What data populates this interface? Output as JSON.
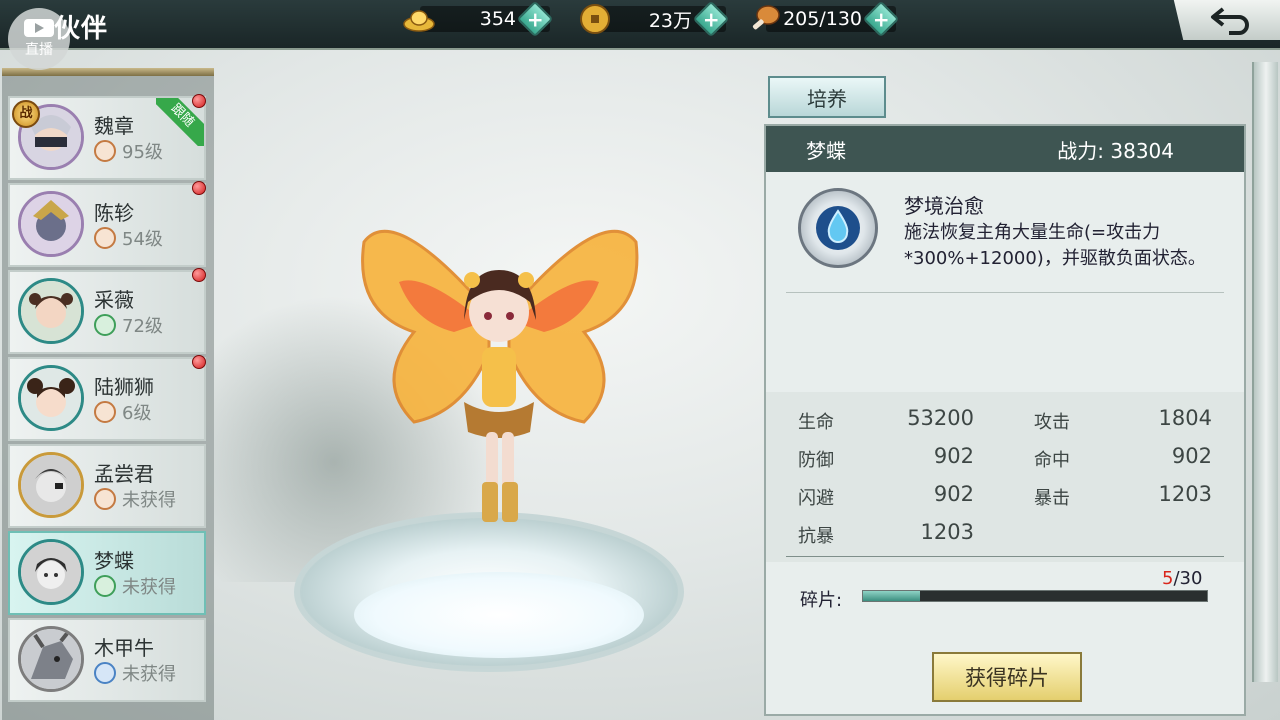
{
  "header": {
    "title": "伙伴",
    "live_label": "直播",
    "resources": [
      {
        "name": "gold-ingot",
        "value": "354"
      },
      {
        "name": "copper-coin",
        "value": "23万"
      },
      {
        "name": "stamina",
        "value": "205/130"
      }
    ],
    "plus_symbol": "+"
  },
  "partners": [
    {
      "name": "魏章",
      "level": "95级",
      "badge": "跟随",
      "combat_badge": "战",
      "class": "orange",
      "selected": false
    },
    {
      "name": "陈轸",
      "level": "54级",
      "class": "orange",
      "selected": false
    },
    {
      "name": "采薇",
      "level": "72级",
      "class": "green",
      "selected": false
    },
    {
      "name": "陆狮狮",
      "level": "6级",
      "class": "orange",
      "selected": false
    },
    {
      "name": "孟尝君",
      "level": "未获得",
      "class": "orange",
      "selected": false
    },
    {
      "name": "梦蝶",
      "level": "未获得",
      "class": "green",
      "selected": true
    },
    {
      "name": "木甲牛",
      "level": "未获得",
      "class": "blue",
      "selected": false
    }
  ],
  "panel": {
    "tab_label": "培养",
    "partner_name": "梦蝶",
    "power_label": "战力:",
    "power_value": "38304",
    "skill": {
      "title": "梦境治愈",
      "description": "施法恢复主角大量生命(=攻击力*300%+12000)，并驱散负面状态。"
    },
    "stats": [
      {
        "label": "生命",
        "value": "53200"
      },
      {
        "label": "攻击",
        "value": "1804"
      },
      {
        "label": "防御",
        "value": "902"
      },
      {
        "label": "命中",
        "value": "902"
      },
      {
        "label": "闪避",
        "value": "902"
      },
      {
        "label": "暴击",
        "value": "1203"
      },
      {
        "label": "抗暴",
        "value": "1203"
      }
    ],
    "fragments": {
      "label": "碎片:",
      "current": "5",
      "total": "/30",
      "fraction": 0.167
    },
    "get_button": "获得碎片"
  },
  "colors": {
    "accent_teal": "#3e5552",
    "red_dot": "#d21e1e",
    "follow_ribbon": "#36a84a"
  }
}
